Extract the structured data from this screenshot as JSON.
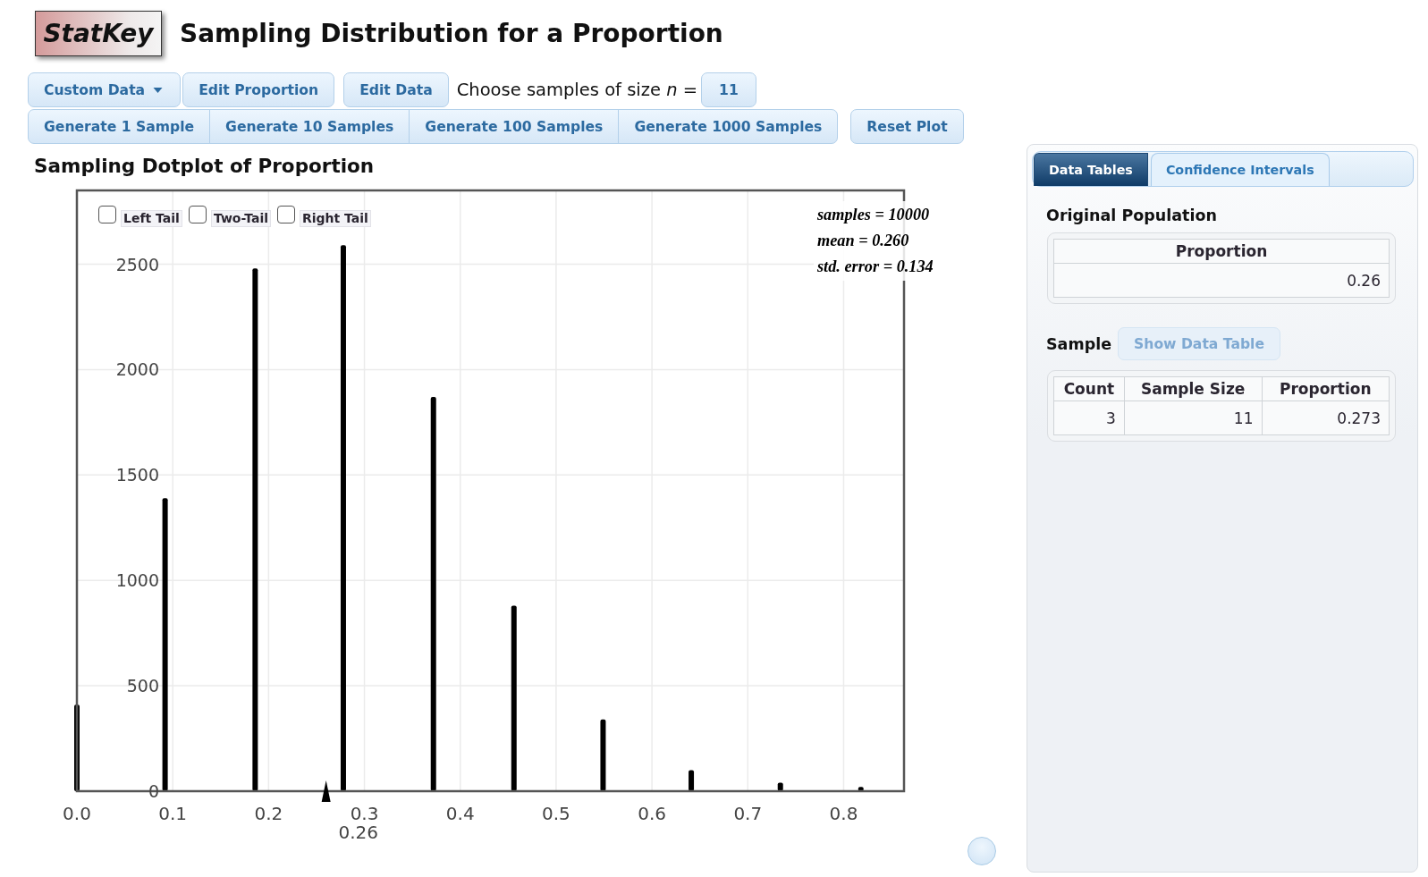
{
  "logo": "StatKey",
  "title": "Sampling Distribution for a Proportion",
  "toolbar": {
    "data_menu": {
      "label": "Custom Data"
    },
    "buttons": [
      {
        "label": "Edit Proportion"
      },
      {
        "label": "Edit Data"
      }
    ],
    "sample_size": {
      "label": "Choose samples of size *n* =",
      "value": "11"
    }
  },
  "generate_buttons": [
    "Generate 1 Sample",
    "Generate 10 Samples",
    "Generate 100 Samples",
    "Generate 1000 Samples"
  ],
  "reset_button": "Reset Plot",
  "dotplot": {
    "tails": [
      {
        "label": "Left Tail",
        "checked": false
      },
      {
        "label": "Two-Tail",
        "checked": false
      },
      {
        "label": "Right Tail",
        "checked": false
      }
    ],
    "stats": [
      "samples = 10000",
      "mean = 0.260",
      "std. error = 0.134"
    ],
    "chart_data": [
      {
        "type": "bar",
        "title": "Sampling Dotplot of Proportion",
        "xlim": [
          0,
          0.863
        ],
        "ylim": [
          0,
          2850
        ],
        "xticks": [
          {
            "value": 0,
            "label": "0.0"
          },
          0.1,
          0.2,
          0.3,
          0.4,
          0.5,
          0.6,
          0.7,
          0.8
        ],
        "yticks": [
          0,
          500,
          1000,
          1500,
          2000,
          2500
        ],
        "grid": true,
        "series": [
          {
            "color": "#000000",
            "x": [
              0,
              0.092,
              0.186,
              0.278,
              0.372,
              0.456,
              0.549,
              0.641,
              0.734,
              0.818
            ],
            "values": [
              410,
              1390,
              2480,
              2590,
              1870,
              880,
              340,
              100,
              40,
              20
            ]
          },
          {
            "type": "scatter",
            "marker": "triangle",
            "color": "#000000",
            "x": [
              0.26
            ],
            "values": [
              0
            ]
          }
        ],
        "annotations": [
          "0.26"
        ]
      }
    ]
  },
  "panel": {
    "tabs": [
      {
        "label": "Data Tables",
        "selected": true
      },
      {
        "label": "Confidence Intervals",
        "selected": false
      }
    ],
    "original_population": {
      "heading": "Original Population",
      "columns": [
        "Proportion"
      ],
      "rows": [
        [
          "0.26"
        ]
      ]
    },
    "sample": {
      "heading": "Sample",
      "button": {
        "label": "Show Data Table",
        "disabled": true
      },
      "columns": [
        "Count",
        "Sample Size",
        "Proportion"
      ],
      "rows": [
        [
          "3",
          "11",
          "0.273"
        ]
      ]
    }
  }
}
